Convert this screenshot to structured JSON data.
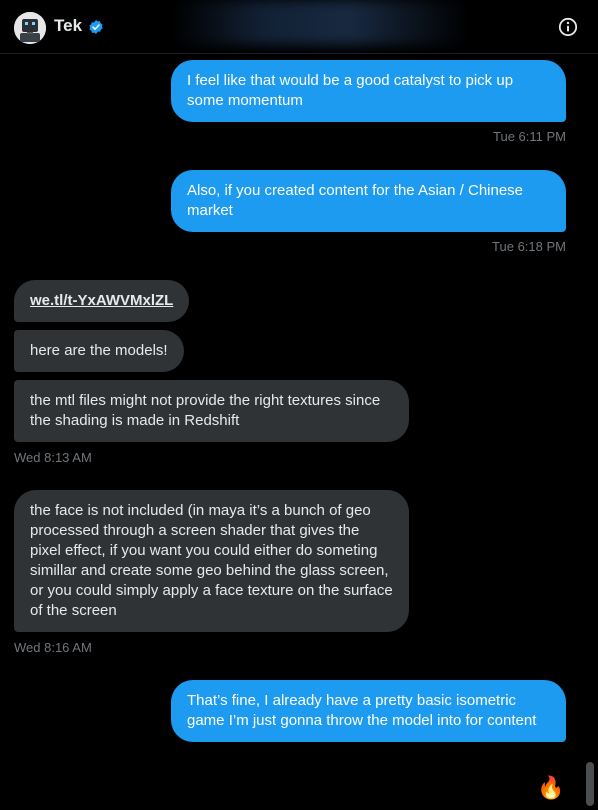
{
  "header": {
    "title": "Tek",
    "verified_icon": "verified-badge-icon",
    "info_icon": "info-icon"
  },
  "messages": [
    {
      "text": "I feel like that would be a good catalyst to pick up some momentum"
    },
    {
      "text": "Also, if you created content for the Asian / Chinese market"
    },
    {
      "text": "we.tl/t-YxAWVMxlZL"
    },
    {
      "text": "here are the models!"
    },
    {
      "text": "the mtl files might not provide the right textures since the shading is made in Redshift"
    },
    {
      "text": "the face is not included (in maya it’s a bunch of geo processed through a screen shader that gives the pixel effect, if you want you could either do someting simillar and create some geo behind the glass screen, or you could simply apply a face texture on the surface of the screen"
    },
    {
      "text": "That’s fine, I already have a pretty basic isometric game I’m just gonna throw the model into for content"
    }
  ],
  "timestamps": [
    "Tue 6:11 PM",
    "Tue 6:18 PM",
    "Wed 8:13 AM",
    "Wed 8:16 AM"
  ],
  "reaction": "🔥",
  "colors": {
    "sent": "#1d9bf0",
    "received": "#2f3336",
    "timestamp": "#71767b",
    "background": "#000000"
  }
}
